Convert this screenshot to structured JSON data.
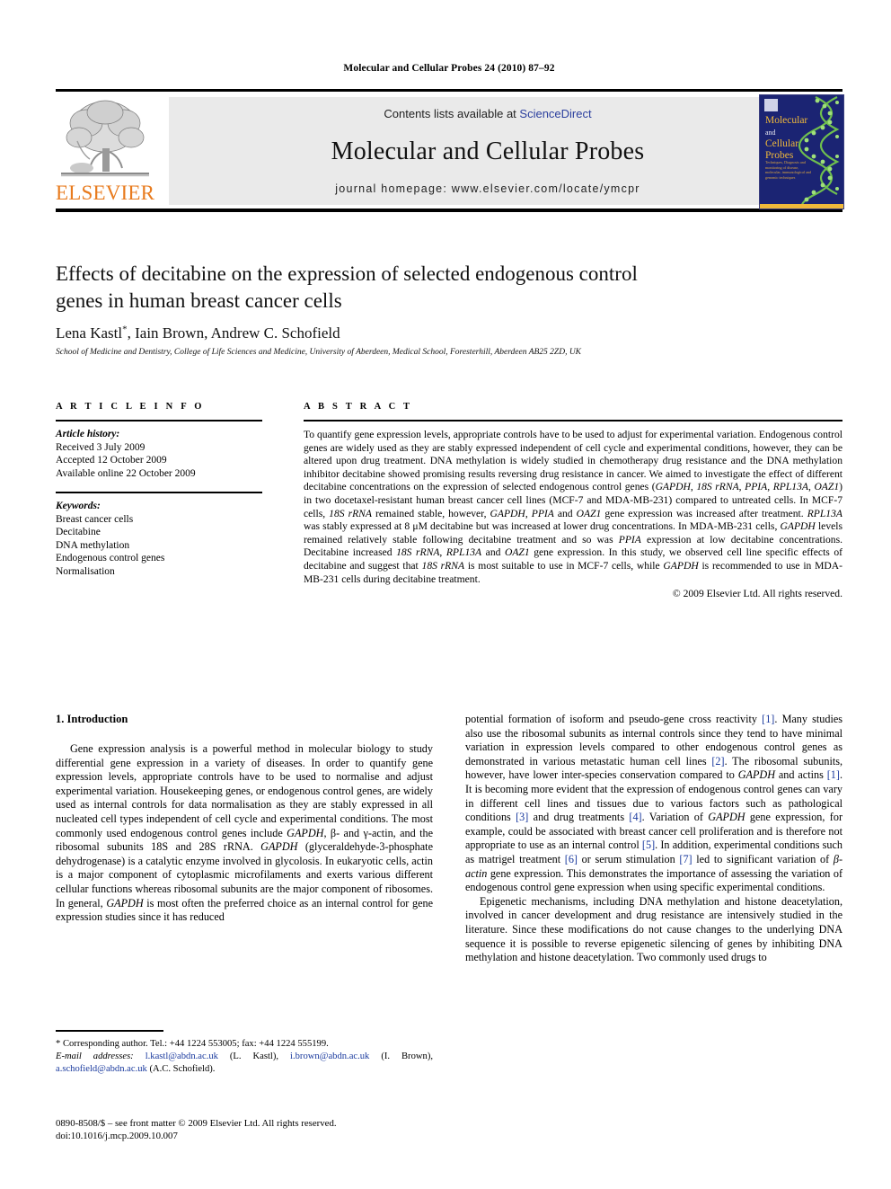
{
  "running_head": "Molecular and Cellular Probes 24 (2010) 87–92",
  "masthead": {
    "contents_prefix": "Contents lists available at ",
    "sciencedirect": "ScienceDirect",
    "journal_title": "Molecular and Cellular Probes",
    "homepage": "journal homepage: www.elsevier.com/locate/ymcpr",
    "publisher_wordmark": "ELSEVIER",
    "cover": {
      "line1": "Molecular",
      "line2": "and",
      "line3": "Cellular",
      "line4": "Probes",
      "blurb": "Techniques, Diagnosis and monitoring of disease, molecular, immunological and genomic techniques"
    }
  },
  "article": {
    "title": "Effects of decitabine on the expression of selected endogenous control genes in human breast cancer cells",
    "authors": "Lena Kastl, Iain Brown, Andrew C. Schofield",
    "author_star": "*",
    "affiliation": "School of Medicine and Dentistry, College of Life Sciences and Medicine, University of Aberdeen, Medical School, Foresterhill, Aberdeen AB25 2ZD, UK"
  },
  "article_info": {
    "heading": "A R T I C L E   I N F O",
    "history_label": "Article history:",
    "history": [
      "Received 3 July 2009",
      "Accepted 12 October 2009",
      "Available online 22 October 2009"
    ],
    "keywords_label": "Keywords:",
    "keywords": [
      "Breast cancer cells",
      "Decitabine",
      "DNA methylation",
      "Endogenous control genes",
      "Normalisation"
    ]
  },
  "abstract": {
    "heading": "A B S T R A C T",
    "text": "To quantify gene expression levels, appropriate controls have to be used to adjust for experimental variation. Endogenous control genes are widely used as they are stably expressed independent of cell cycle and experimental conditions, however, they can be altered upon drug treatment. DNA methylation is widely studied in chemotherapy drug resistance and the DNA methylation inhibitor decitabine showed promising results reversing drug resistance in cancer. We aimed to investigate the effect of different decitabine concentrations on the expression of selected endogenous control genes (GAPDH, 18S rRNA, PPIA, RPL13A, OAZ1) in two docetaxel-resistant human breast cancer cell lines (MCF-7 and MDA-MB-231) compared to untreated cells. In MCF-7 cells, 18S rRNA remained stable, however, GAPDH, PPIA and OAZ1 gene expression was increased after treatment. RPL13A was stably expressed at 8 μM decitabine but was increased at lower drug concentrations. In MDA-MB-231 cells, GAPDH levels remained relatively stable following decitabine treatment and so was PPIA expression at low decitabine concentrations. Decitabine increased 18S rRNA, RPL13A and OAZ1 gene expression. In this study, we observed cell line specific effects of decitabine and suggest that 18S rRNA is most suitable to use in MCF-7 cells, while GAPDH is recommended to use in MDA-MB-231 cells during decitabine treatment.",
    "copyright": "© 2009 Elsevier Ltd. All rights reserved."
  },
  "body": {
    "section_number_title": "1.  Introduction",
    "left_paragraph_1": "Gene expression analysis is a powerful method in molecular biology to study differential gene expression in a variety of diseases. In order to quantify gene expression levels, appropriate controls have to be used to normalise and adjust experimental variation. Housekeeping genes, or endogenous control genes, are widely used as internal controls for data normalisation as they are stably expressed in all nucleated cell types independent of cell cycle and experimental conditions. The most commonly used endogenous control genes include GAPDH, β- and γ-actin, and the ribosomal subunits 18S and 28S rRNA. GAPDH (glyceraldehyde-3-phosphate dehydrogenase) is a catalytic enzyme involved in glycolosis. In eukaryotic cells, actin is a major component of cytoplasmic microfilaments and exerts various different cellular functions whereas ribosomal subunits are the major component of ribosomes. In general, GAPDH is most often the preferred choice as an internal control for gene expression studies since it has reduced",
    "right_paragraph_1": "potential formation of isoform and pseudo-gene cross reactivity [1]. Many studies also use the ribosomal subunits as internal controls since they tend to have minimal variation in expression levels compared to other endogenous control genes as demonstrated in various metastatic human cell lines [2]. The ribosomal subunits, however, have lower inter-species conservation compared to GAPDH and actins [1]. It is becoming more evident that the expression of endogenous control genes can vary in different cell lines and tissues due to various factors such as pathological conditions [3] and drug treatments [4]. Variation of GAPDH gene expression, for example, could be associated with breast cancer cell proliferation and is therefore not appropriate to use as an internal control [5]. In addition, experimental conditions such as matrigel treatment [6] or serum stimulation [7] led to significant variation of β-actin gene expression. This demonstrates the importance of assessing the variation of endogenous control gene expression when using specific experimental conditions.",
    "right_paragraph_2": "Epigenetic mechanisms, including DNA methylation and histone deacetylation, involved in cancer development and drug resistance are intensively studied in the literature. Since these modifications do not cause changes to the underlying DNA sequence it is possible to reverse epigenetic silencing of genes by inhibiting DNA methylation and histone deacetylation. Two commonly used drugs to"
  },
  "footnotes": {
    "corresponding": "* Corresponding author. Tel.: +44 1224 553005; fax: +44 1224 555199.",
    "email_label": "E-mail addresses:",
    "email_1": "l.kastl@abdn.ac.uk",
    "email_1_name": "(L. Kastl),",
    "email_2": "i.brown@abdn.ac.uk",
    "email_2_name": "(I. Brown),",
    "email_3": "a.schofield@abdn.ac.uk",
    "email_3_name": "(A.C. Schofield).",
    "issn_line": "0890-8508/$ – see front matter © 2009 Elsevier Ltd. All rights reserved.",
    "doi_line": "doi:10.1016/j.mcp.2009.10.007"
  },
  "colors": {
    "link": "#1a3a9e",
    "elsevier_orange": "#E87B1E",
    "panel_grey": "#eaeaea",
    "cover_blue": "#1b2473",
    "cover_gold": "#f0b93a"
  }
}
